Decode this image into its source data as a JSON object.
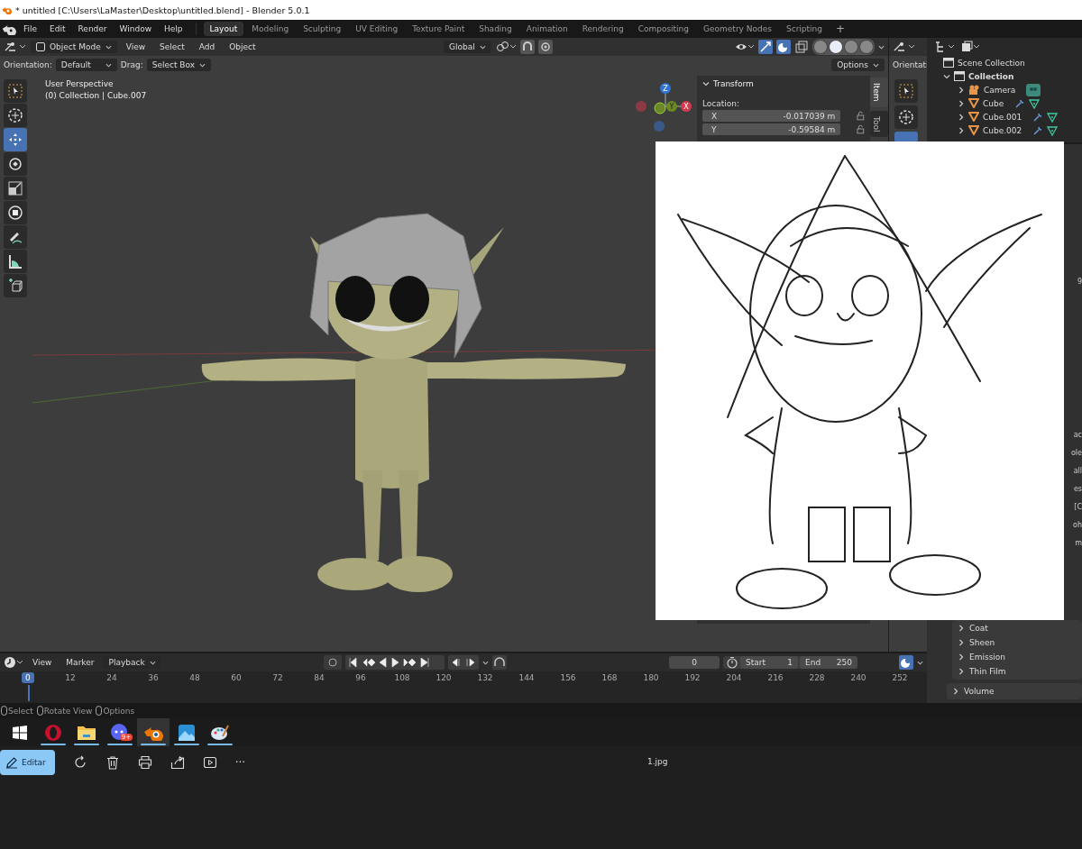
{
  "title_bar": {
    "title": "* untitled [C:\\Users\\LaMaster\\Desktop\\untitled.blend] - Blender 5.0.1"
  },
  "menu": [
    "File",
    "Edit",
    "Render",
    "Window",
    "Help"
  ],
  "workspaces": [
    {
      "label": "Layout",
      "selected": true
    },
    {
      "label": "Modeling",
      "selected": false
    },
    {
      "label": "Sculpting",
      "selected": false
    },
    {
      "label": "UV Editing",
      "selected": false
    },
    {
      "label": "Texture Paint",
      "selected": false
    },
    {
      "label": "Shading",
      "selected": false
    },
    {
      "label": "Animation",
      "selected": false
    },
    {
      "label": "Rendering",
      "selected": false
    },
    {
      "label": "Compositing",
      "selected": false
    },
    {
      "label": "Geometry Nodes",
      "selected": false
    },
    {
      "label": "Scripting",
      "selected": false
    }
  ],
  "add_workspace": "+",
  "viewport": {
    "mode": "Object Mode",
    "menus": [
      "View",
      "Select",
      "Add",
      "Object"
    ],
    "transform_orientation": "Global",
    "shading": [
      {
        "selected": false
      },
      {
        "selected": true
      },
      {
        "selected": false
      },
      {
        "selected": false
      }
    ],
    "orientation_label": "Orientation:",
    "orientation": "Default",
    "drag_label": "Drag:",
    "drag": "Select Box",
    "options": "Options",
    "overlay_text": [
      "User Perspective",
      "(0) Collection | Cube.007"
    ],
    "gizmo": {
      "z": "Z",
      "y": "Y",
      "x": "X"
    }
  },
  "tools": [
    {
      "kind": "select",
      "selected": false
    },
    {
      "kind": "cursor",
      "selected": false
    },
    {
      "kind": "move",
      "selected": true
    },
    {
      "kind": "rotate",
      "selected": false
    },
    {
      "kind": "scale",
      "selected": false
    },
    {
      "kind": "transform",
      "selected": false
    },
    {
      "kind": "annotate",
      "selected": false
    },
    {
      "kind": "measure",
      "selected": false
    },
    {
      "kind": "add-cube",
      "selected": false
    }
  ],
  "sidebar": {
    "panel": "Transform",
    "location_label": "Location:",
    "fields": [
      {
        "axis": "X",
        "value": "-0.017039 m"
      },
      {
        "axis": "Y",
        "value": "-0.59584 m"
      }
    ],
    "tabs": [
      {
        "label": "Item",
        "selected": true
      },
      {
        "label": "Tool",
        "selected": false
      }
    ]
  },
  "second_editor": {
    "label": "Orientati"
  },
  "outliner": {
    "root": "Scene Collection",
    "items": [
      {
        "label": "Collection",
        "expanded": true,
        "children": [
          {
            "label": "Camera",
            "kind": "camera",
            "expanded": false
          },
          {
            "label": "Cube",
            "kind": "mesh",
            "expanded": false
          },
          {
            "label": "Cube.001",
            "kind": "mesh",
            "expanded": false
          },
          {
            "label": "Cube.002",
            "kind": "mesh",
            "expanded": false
          }
        ]
      }
    ]
  },
  "properties": {
    "cut_texts": [
      "9",
      "ac",
      "ole",
      "all",
      "es",
      "[C",
      "oh",
      "m"
    ],
    "sections": [
      {
        "label": "Coat",
        "expanded": false
      },
      {
        "label": "Sheen",
        "expanded": false
      },
      {
        "label": "Emission",
        "expanded": false
      },
      {
        "label": "Thin Film",
        "expanded": false
      }
    ],
    "group": {
      "label": "Volume",
      "expanded": false
    }
  },
  "timeline": {
    "menus": [
      "View",
      "Marker"
    ],
    "playback": "Playback",
    "frame": "0",
    "start_label": "Start",
    "start": "1",
    "end_label": "End",
    "end": "250",
    "current": "0",
    "ticks": [
      "12",
      "24",
      "36",
      "48",
      "60",
      "72",
      "84",
      "96",
      "108",
      "120",
      "132",
      "144",
      "156",
      "168",
      "180",
      "192",
      "204",
      "216",
      "228",
      "240",
      "252"
    ]
  },
  "status_bar": [
    "Select",
    "Rotate View",
    "Options"
  ],
  "taskbar": [
    {
      "kind": "start",
      "selected": false,
      "running": false
    },
    {
      "kind": "opera",
      "selected": false,
      "running": true
    },
    {
      "kind": "folder",
      "selected": false,
      "running": true
    },
    {
      "kind": "chat",
      "selected": false,
      "running": true,
      "badge": "9+"
    },
    {
      "kind": "blender",
      "selected": true,
      "running": true
    },
    {
      "kind": "photos",
      "selected": false,
      "running": true
    },
    {
      "kind": "paint",
      "selected": false,
      "running": true
    }
  ],
  "photo_viewer": {
    "edit_button": "Editar",
    "actions": [
      {
        "kind": "rotate"
      },
      {
        "kind": "delete"
      },
      {
        "kind": "print"
      },
      {
        "kind": "share"
      },
      {
        "kind": "slideshow"
      }
    ],
    "more": "···",
    "file_name": "1.jpg"
  }
}
